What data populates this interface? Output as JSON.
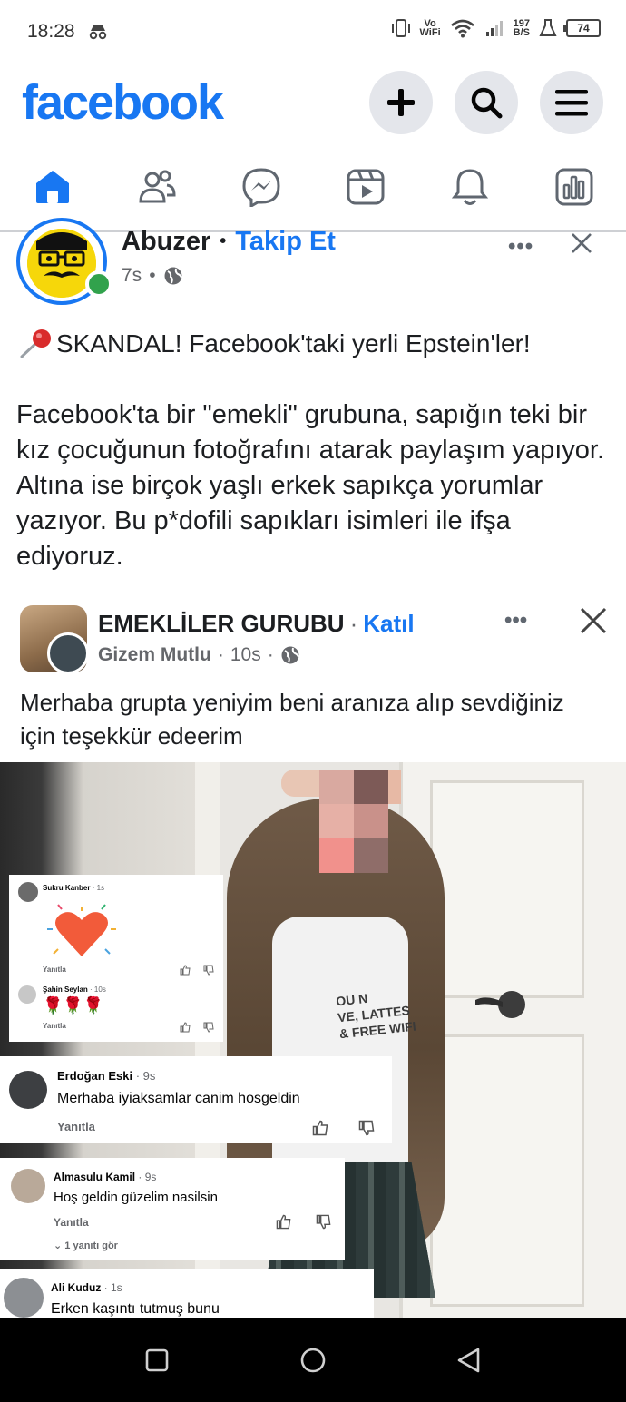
{
  "status_bar": {
    "time": "18:28",
    "volte_top": "Vo",
    "volte_bottom": "WiFi",
    "speed_top": "197",
    "speed_bottom": "B/S",
    "battery": "74"
  },
  "header": {
    "logo": "facebook"
  },
  "nav": {
    "tabs": [
      "home-icon",
      "friends-icon",
      "messenger-icon",
      "video-icon",
      "notifications-icon",
      "dashboard-icon"
    ],
    "active_color": "#1877f2"
  },
  "post": {
    "author": "Abuzer",
    "separator": "•",
    "follow": "Takip Et",
    "time": "7s",
    "meta_sep": "•",
    "more": "•••",
    "headline": "SKANDAL! Facebook'taki yerli Epstein'ler!",
    "body": "Facebook'ta bir \"emekli\" grubuna, sapığın teki bir kız çocuğunun fotoğrafını atarak paylaşım yapıyor. Altına ise birçok yaşlı erkek sapıkça yorumlar yazıyor. Bu p*dofili sapıkları isimleri ile ifşa ediyoruz."
  },
  "shared": {
    "group_name": "EMEKLİLER GURUBU",
    "join_sep": "·",
    "join": "Katıl",
    "author": "Gizem Mutlu",
    "time": "10s",
    "meta_sep": "·",
    "more": "•••",
    "text": "Merhaba grupta yeniyim beni aranıza alıp sevdiğiniz için teşekkür edeerim",
    "shirt_text": "OU N\nVE, LATTES\n& FREE WIFI"
  },
  "comments": [
    {
      "name": "Sukru Kanber",
      "time": "· 1s",
      "reply": "Yanıtla"
    },
    {
      "name": "Şahin Seylan",
      "time": "· 10s",
      "text": "🌹🌹🌹",
      "reply": "Yanıtla"
    },
    {
      "name": "Erdoğan Eski",
      "time": "· 9s",
      "text": "Merhaba iyiaksamlar canim  hosgeldin",
      "reply": "Yanıtla"
    },
    {
      "name": "Almasulu Kamil",
      "time": "· 9s",
      "text": "Hoş geldin güzelim nasilsin",
      "reply": "Yanıtla",
      "more_replies": "1 yanıtı gör"
    },
    {
      "name": "Ali Kuduz",
      "time": "· 1s",
      "text": "Erken kaşıntı tutmuş bunu"
    }
  ],
  "colors": {
    "brand": "#1877f2",
    "text": "#1c1e21",
    "secondary": "#65676b",
    "online": "#31a24c"
  }
}
